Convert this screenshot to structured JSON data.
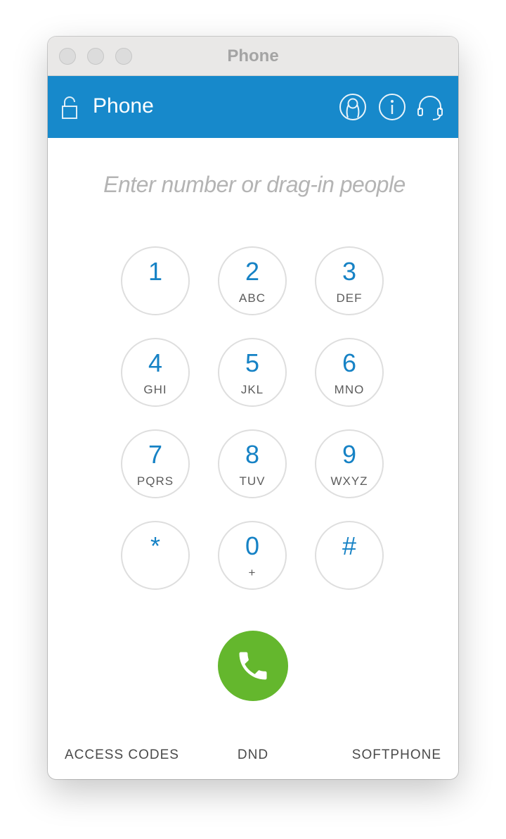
{
  "window": {
    "title": "Phone"
  },
  "header": {
    "title": "Phone",
    "icons": [
      "lock-icon",
      "contacts-icon",
      "info-icon",
      "headset-icon"
    ],
    "accent_color": "#1789cb"
  },
  "dialer": {
    "placeholder": "Enter number or drag-in people",
    "value": ""
  },
  "keypad": [
    {
      "digit": "1",
      "letters": ""
    },
    {
      "digit": "2",
      "letters": "ABC"
    },
    {
      "digit": "3",
      "letters": "DEF"
    },
    {
      "digit": "4",
      "letters": "GHI"
    },
    {
      "digit": "5",
      "letters": "JKL"
    },
    {
      "digit": "6",
      "letters": "MNO"
    },
    {
      "digit": "7",
      "letters": "PQRS"
    },
    {
      "digit": "8",
      "letters": "TUV"
    },
    {
      "digit": "9",
      "letters": "WXYZ"
    },
    {
      "digit": "*",
      "letters": ""
    },
    {
      "digit": "0",
      "letters": "+"
    },
    {
      "digit": "#",
      "letters": ""
    }
  ],
  "call": {
    "icon": "phone-handset-icon",
    "color": "#64b72d"
  },
  "footer": {
    "access_codes": "ACCESS CODES",
    "dnd": "DND",
    "softphone": "SOFTPHONE"
  }
}
